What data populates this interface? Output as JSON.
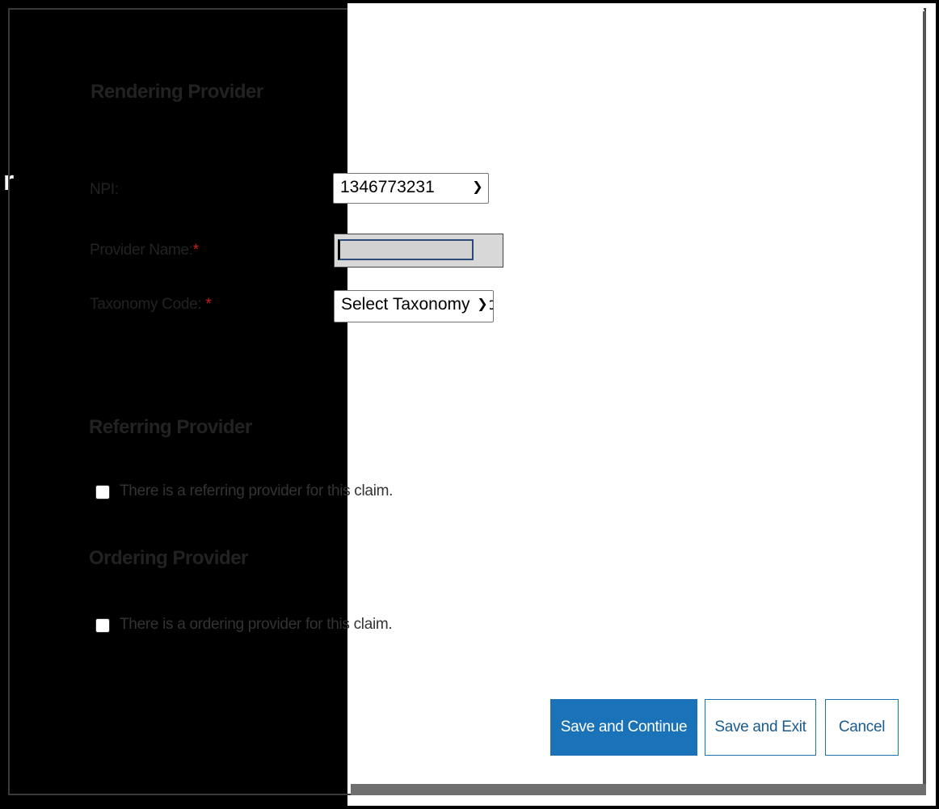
{
  "rendering": {
    "title": "Rendering Provider",
    "npi_label": "NPI:",
    "npi_value": "1346773231",
    "provider_name_label": "Provider Name:",
    "taxonomy_label": "Taxonomy Code:",
    "taxonomy_value": "Select Taxonomy Co",
    "required_mark": "*"
  },
  "referring": {
    "title": "Referring Provider",
    "checkbox_label": "There is a referring provider for this claim.",
    "checked": false
  },
  "ordering": {
    "title": "Ordering Provider",
    "checkbox_label": "There is a ordering provider for this claim.",
    "checked": false
  },
  "buttons": {
    "save_continue": "Save and Continue",
    "save_exit": "Save and Exit",
    "cancel": "Cancel"
  },
  "colors": {
    "primary": "#1a73b8",
    "required": "#cc1b1b"
  },
  "icons": {
    "select_arrow": "chevron-down-icon"
  }
}
